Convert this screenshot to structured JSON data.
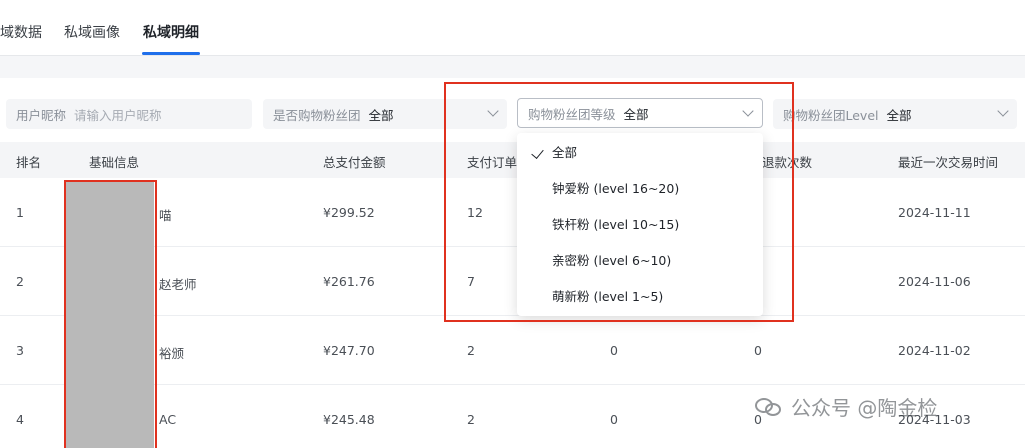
{
  "tabs": [
    {
      "label": "域数据"
    },
    {
      "label": "私域画像"
    },
    {
      "label": "私域明细",
      "active": true
    }
  ],
  "filters": {
    "nickname": {
      "label": "用户昵称",
      "placeholder": "请输入用户昵称"
    },
    "is_fan_group": {
      "label": "是否购物粉丝团",
      "value": "全部"
    },
    "fan_group_tier": {
      "label": "购物粉丝团等级",
      "value": "全部"
    },
    "fan_group_level": {
      "label": "购物粉丝团Level",
      "value": "全部"
    }
  },
  "dropdown": {
    "options": [
      "全部",
      "钟爱粉 (level 16~20)",
      "铁杆粉 (level 10~15)",
      "亲密粉 (level 6~10)",
      "萌新粉 (level 1~5)"
    ],
    "selected": "全部"
  },
  "table": {
    "headers": [
      "排名",
      "基础信息",
      "总支付金额",
      "支付订单",
      "退款次数",
      "最近一次交易时间"
    ],
    "rows": [
      {
        "rank": "1",
        "name": "喵",
        "amount": "¥299.52",
        "orders": "12",
        "col5": "",
        "refunds": "",
        "last": "2024-11-11"
      },
      {
        "rank": "2",
        "name": "赵老师",
        "amount": "¥261.76",
        "orders": "7",
        "col5": "",
        "refunds": "",
        "last": "2024-11-06"
      },
      {
        "rank": "3",
        "name": "裕颁",
        "amount": "¥247.70",
        "orders": "2",
        "col5": "0",
        "refunds": "0",
        "last": "2024-11-02"
      },
      {
        "rank": "4",
        "name": "AC",
        "amount": "¥245.48",
        "orders": "2",
        "col5": "0",
        "refunds": "0",
        "last": "2024-11-03"
      }
    ]
  },
  "watermark": "公众号 @陶金检",
  "colors": {
    "accent": "#1f6feb",
    "annotation": "#e0311f"
  }
}
